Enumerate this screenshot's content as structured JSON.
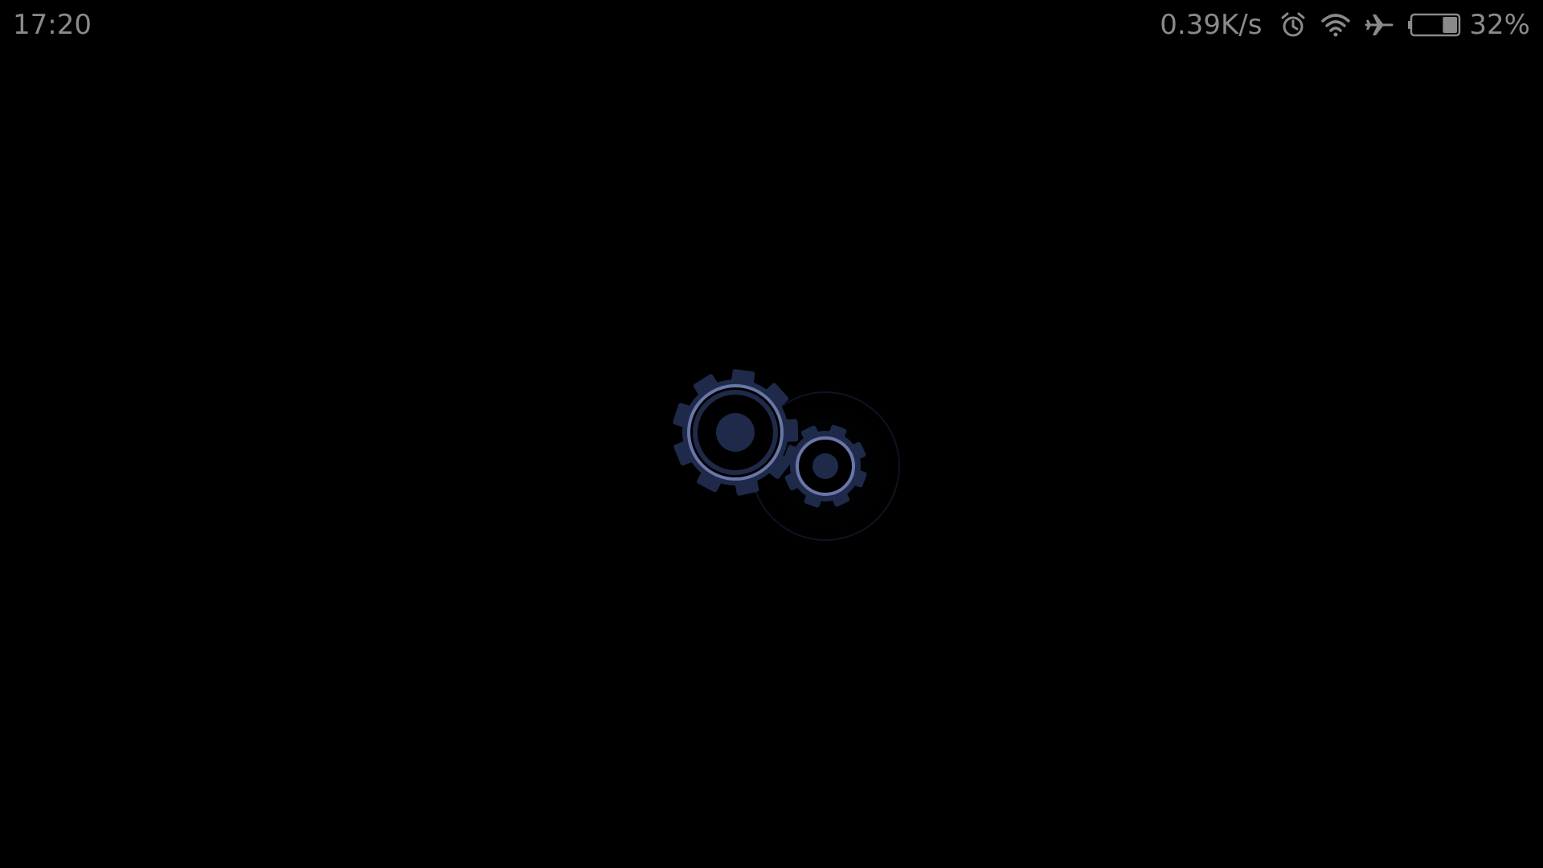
{
  "status_bar": {
    "time": "17:20",
    "network_speed": "0.39K/s",
    "battery_percent": "32%",
    "battery_level": 0.32,
    "icons": [
      "alarm-icon",
      "wifi-icon",
      "airplane-mode-icon",
      "battery-icon"
    ]
  },
  "loader": {
    "icon": "gears-loading-icon"
  },
  "colors": {
    "background": "#000000",
    "status_text": "#8a8a8a",
    "gear_fill": "#1f2a4a",
    "gear_ring": "#6a76a8"
  }
}
